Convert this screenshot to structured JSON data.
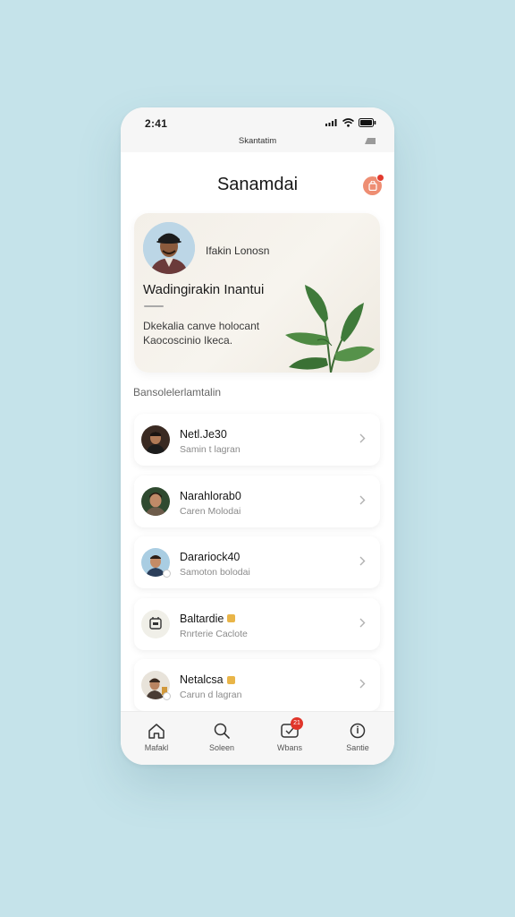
{
  "status_bar": {
    "time": "2:41",
    "host": "Skantatim"
  },
  "header": {
    "title": "Sanamdai"
  },
  "profile_card": {
    "name": "Ifakin Lonosn",
    "headline": "Wadingirakin Inantui",
    "description": "Dkekalia canve holocant Kaocoscinio Ikeca."
  },
  "section": {
    "label": "Bansolelerlamtalin"
  },
  "contacts": [
    {
      "name": "Netl.Je30",
      "status": "Samin t lagran",
      "badge": ""
    },
    {
      "name": "Narahlorab0",
      "status": "Caren Molodai",
      "badge": ""
    },
    {
      "name": "Darariock40",
      "status": "Samoton bolodai",
      "badge": ""
    },
    {
      "name": "Baltardie",
      "status": "Rnrterie Caclote",
      "badge": "emoji"
    },
    {
      "name": "Netalcsa",
      "status": "Carun d lagran",
      "badge": "emoji"
    }
  ],
  "bottom_nav": {
    "items": [
      {
        "label": "Mafakl",
        "icon": "home-icon"
      },
      {
        "label": "Soleen",
        "icon": "search-icon"
      },
      {
        "label": "Wbans",
        "icon": "chat-icon",
        "badge": "21"
      },
      {
        "label": "Santie",
        "icon": "info-icon"
      }
    ]
  },
  "colors": {
    "background": "#c5e3ea",
    "accent": "#ee8e73",
    "badge_red": "#e23a2e"
  }
}
